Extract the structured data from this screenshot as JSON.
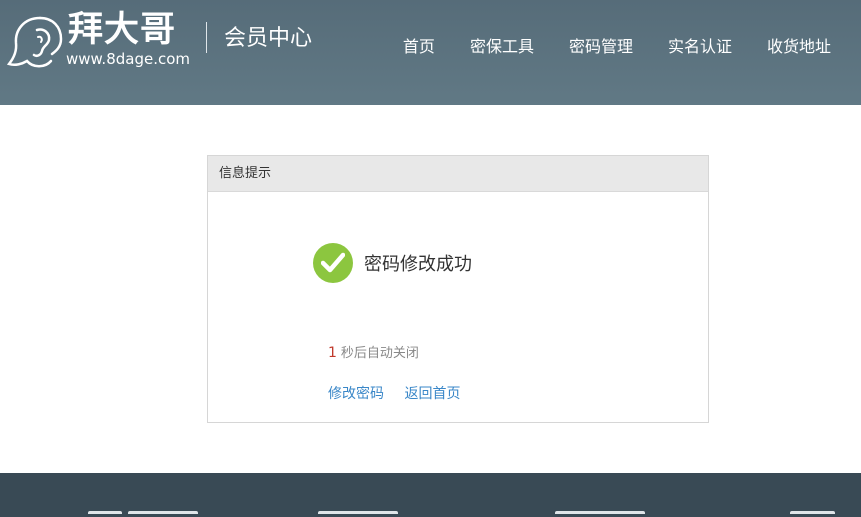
{
  "header": {
    "logo_title": "拜大哥",
    "logo_url": "www.8dage.com",
    "center_title": "会员中心",
    "nav": [
      "首页",
      "密保工具",
      "密码管理",
      "实名认证",
      "收货地址"
    ]
  },
  "panel": {
    "title": "信息提示",
    "message": "密码修改成功",
    "countdown_seconds": "1",
    "countdown_text": "秒后自动关闭",
    "links": [
      "修改密码",
      "返回首页"
    ]
  },
  "colors": {
    "header_bg": "#5e7380",
    "success_green": "#8cc63f",
    "link_blue": "#3a87c8",
    "countdown_red": "#c0392b",
    "footer_bg": "#394a55"
  },
  "icons": [
    "ear-logo-icon",
    "check-circle-icon"
  ]
}
